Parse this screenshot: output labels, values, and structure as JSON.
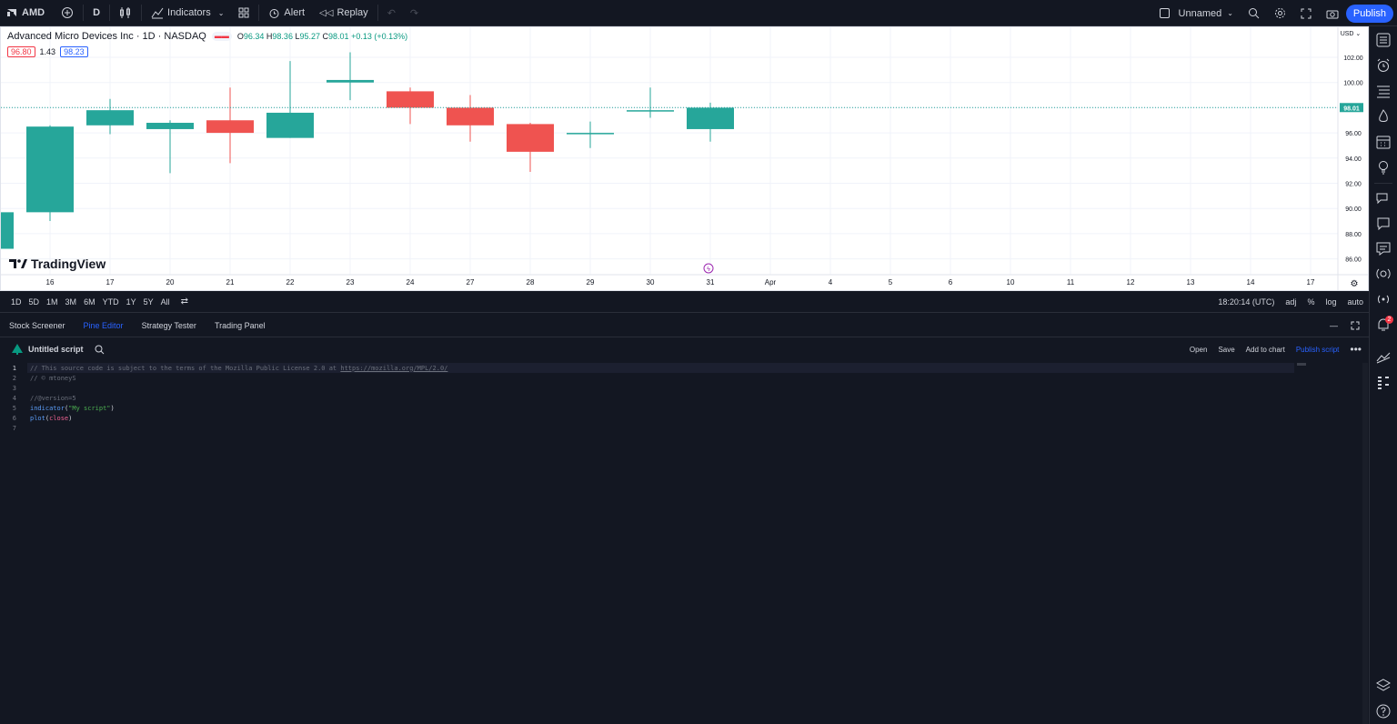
{
  "topbar": {
    "symbol": "AMD",
    "interval": "D",
    "indicators_label": "Indicators",
    "alert_label": "Alert",
    "replay_label": "Replay",
    "layout_name": "Unnamed",
    "publish_label": "Publish"
  },
  "chart": {
    "title": "Advanced Micro Devices Inc · 1D · NASDAQ",
    "ohlc": {
      "o_label": "O",
      "o": "96.34",
      "h_label": "H",
      "h": "98.36",
      "l_label": "L",
      "l": "95.27",
      "c_label": "C",
      "c": "98.01",
      "change": "+0.13 (+0.13%)"
    },
    "sell_price": "96.80",
    "spread": "1.43",
    "buy_price": "98.23",
    "currency": "USD",
    "current_price": "98.01",
    "y_ticks": [
      "102.00",
      "100.00",
      "98.00",
      "96.00",
      "94.00",
      "92.00",
      "90.00",
      "88.00",
      "86.00"
    ],
    "x_ticks": [
      "16",
      "17",
      "20",
      "21",
      "22",
      "23",
      "24",
      "27",
      "28",
      "29",
      "30",
      "31",
      "Apr",
      "4",
      "5",
      "6",
      "10",
      "11",
      "12",
      "13",
      "14",
      "17"
    ],
    "logo_text": "TradingView",
    "colors": {
      "up": "#26a69a",
      "down": "#ef5350",
      "background": "#ffffff"
    }
  },
  "chart_data": {
    "type": "candlestick",
    "categories": [
      "16",
      "17",
      "20",
      "21",
      "22",
      "23",
      "24",
      "27",
      "28",
      "29",
      "30",
      "31"
    ],
    "ylim": [
      85,
      103
    ],
    "series": [
      {
        "open": 89.7,
        "high": 96.6,
        "low": 89.0,
        "close": 96.5
      },
      {
        "open": 96.6,
        "high": 98.7,
        "low": 95.9,
        "close": 97.8
      },
      {
        "open": 96.3,
        "high": 97.0,
        "low": 92.8,
        "close": 96.8
      },
      {
        "open": 97.0,
        "high": 99.6,
        "low": 93.6,
        "close": 96.0
      },
      {
        "open": 95.6,
        "high": 101.7,
        "low": 95.6,
        "close": 97.6
      },
      {
        "open": 100.0,
        "high": 102.4,
        "low": 98.6,
        "close": 100.2
      },
      {
        "open": 99.3,
        "high": 99.6,
        "low": 96.7,
        "close": 98.0
      },
      {
        "open": 98.0,
        "high": 99.0,
        "low": 95.3,
        "close": 96.6
      },
      {
        "open": 96.7,
        "high": 96.8,
        "low": 92.9,
        "close": 94.5
      },
      {
        "open": 96.0,
        "high": 96.9,
        "low": 94.8,
        "close": 96.0
      },
      {
        "open": 97.8,
        "high": 99.6,
        "low": 97.2,
        "close": 97.8
      },
      {
        "open": 96.3,
        "high": 98.4,
        "low": 95.3,
        "close": 98.0
      }
    ]
  },
  "range_bar": {
    "ranges": [
      "1D",
      "5D",
      "1M",
      "3M",
      "6M",
      "YTD",
      "1Y",
      "5Y",
      "All"
    ],
    "time": "18:20:14 (UTC)",
    "adj": "adj",
    "percent": "%",
    "log": "log",
    "auto": "auto"
  },
  "panel": {
    "tabs": [
      "Stock Screener",
      "Pine Editor",
      "Strategy Tester",
      "Trading Panel"
    ],
    "active_tab": "Pine Editor",
    "script_name": "Untitled script",
    "actions": [
      "Open",
      "Save",
      "Add to chart",
      "Publish script"
    ]
  },
  "code": {
    "lines": [
      {
        "n": "1",
        "text": "// This source code is subject to the terms of the Mozilla Public License 2.0 at ",
        "link": "https://mozilla.org/MPL/2.0/"
      },
      {
        "n": "2",
        "text": "// © mtoneyS"
      },
      {
        "n": "3",
        "text": ""
      },
      {
        "n": "4",
        "text": "//@version=5"
      },
      {
        "n": "5",
        "text": "indicator(\"My script\")"
      },
      {
        "n": "6",
        "text": "plot(close)"
      },
      {
        "n": "7",
        "text": ""
      }
    ]
  },
  "sidebar": {
    "notification_count": "2"
  }
}
